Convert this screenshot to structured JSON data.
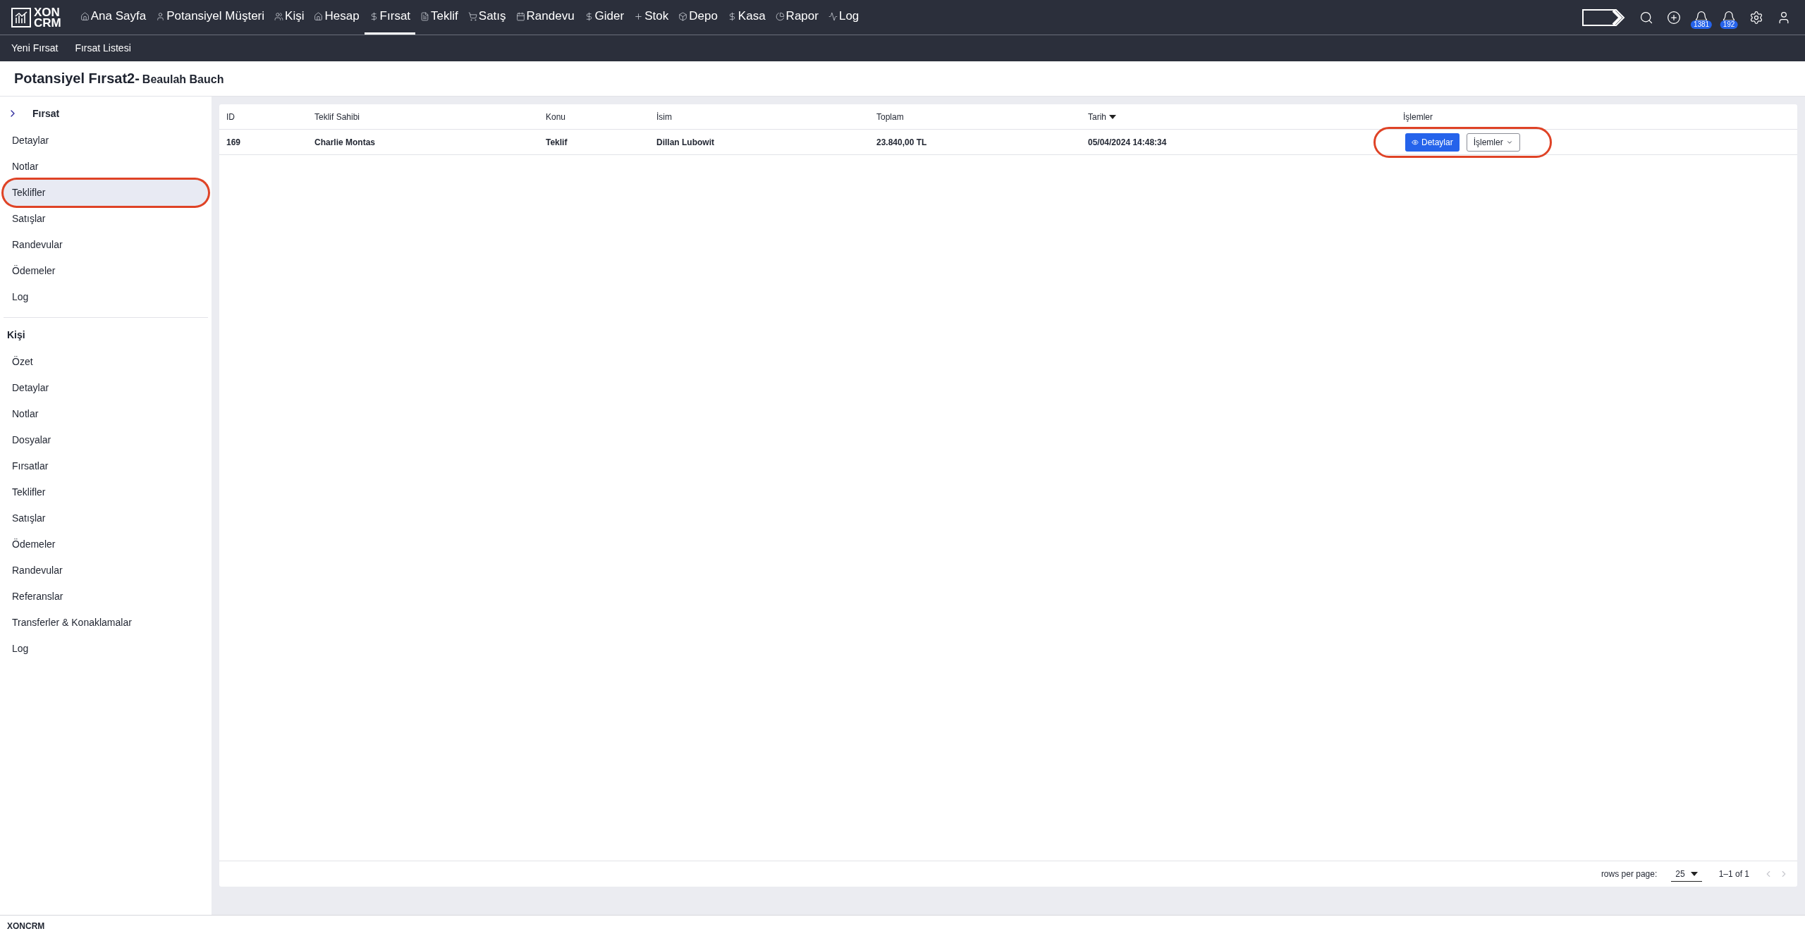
{
  "logo": {
    "line1": "XON",
    "line2": "CRM"
  },
  "nav": [
    {
      "label": "Ana Sayfa",
      "selected": false
    },
    {
      "label": "Potansiyel Müşteri",
      "selected": false
    },
    {
      "label": "Kişi",
      "selected": false
    },
    {
      "label": "Hesap",
      "selected": false
    },
    {
      "label": "Fırsat",
      "selected": true
    },
    {
      "label": "Teklif",
      "selected": false
    },
    {
      "label": "Satış",
      "selected": false
    },
    {
      "label": "Randevu",
      "selected": false
    },
    {
      "label": "Gider",
      "selected": false
    },
    {
      "label": "Stok",
      "selected": false
    },
    {
      "label": "Depo",
      "selected": false
    },
    {
      "label": "Kasa",
      "selected": false
    },
    {
      "label": "Rapor",
      "selected": false
    },
    {
      "label": "Log",
      "selected": false
    }
  ],
  "notifications": [
    {
      "count": "1381"
    },
    {
      "count": "192"
    }
  ],
  "subnav": [
    "Yeni Fırsat",
    "Fırsat Listesi"
  ],
  "page_title": {
    "main": "Potansiyel Fırsat2-",
    "sub": "Beaulah Bauch"
  },
  "sidebar": {
    "sections": [
      {
        "title": "Fırsat",
        "expanded": true,
        "items": [
          {
            "label": "Detaylar",
            "selected": false,
            "highlighted": false
          },
          {
            "label": "Notlar",
            "selected": false,
            "highlighted": false
          },
          {
            "label": "Teklifler",
            "selected": true,
            "highlighted": true
          },
          {
            "label": "Satışlar",
            "selected": false,
            "highlighted": false
          },
          {
            "label": "Randevular",
            "selected": false,
            "highlighted": false
          },
          {
            "label": "Ödemeler",
            "selected": false,
            "highlighted": false
          },
          {
            "label": "Log",
            "selected": false,
            "highlighted": false
          }
        ]
      },
      {
        "title": "Kişi",
        "items": [
          {
            "label": "Özet",
            "selected": false,
            "highlighted": false
          },
          {
            "label": "Detaylar",
            "selected": false,
            "highlighted": false
          },
          {
            "label": "Notlar",
            "selected": false,
            "highlighted": false
          },
          {
            "label": "Dosyalar",
            "selected": false,
            "highlighted": false
          },
          {
            "label": "Fırsatlar",
            "selected": false,
            "highlighted": false
          },
          {
            "label": "Teklifler",
            "selected": false,
            "highlighted": false
          },
          {
            "label": "Satışlar",
            "selected": false,
            "highlighted": false
          },
          {
            "label": "Ödemeler",
            "selected": false,
            "highlighted": false
          },
          {
            "label": "Randevular",
            "selected": false,
            "highlighted": false
          },
          {
            "label": "Referanslar",
            "selected": false,
            "highlighted": false
          },
          {
            "label": "Transferler & Konaklamalar",
            "selected": false,
            "highlighted": false
          },
          {
            "label": "Log",
            "selected": false,
            "highlighted": false
          }
        ]
      }
    ]
  },
  "table": {
    "columns": [
      {
        "label": "ID",
        "sorted": false
      },
      {
        "label": "Teklif Sahibi",
        "sorted": false
      },
      {
        "label": "Konu",
        "sorted": false
      },
      {
        "label": "İsim",
        "sorted": false
      },
      {
        "label": "Toplam",
        "sorted": false
      },
      {
        "label": "Tarih",
        "sorted": true
      },
      {
        "label": "İşlemler",
        "sorted": false
      }
    ],
    "rows": [
      {
        "cells": [
          "169",
          "Charlie Montas",
          "Teklif",
          "Dillan Lubowit",
          "23.840,00 TL",
          "05/04/2024 14:48:34"
        ],
        "actions": {
          "primary": "Detaylar",
          "menu": "İşlemler"
        },
        "highlighted": true
      }
    ],
    "pagination": {
      "rows_label": "rows per page:",
      "rows_value": "25",
      "range": "1–1 of 1"
    }
  },
  "footer": "XONCRM"
}
